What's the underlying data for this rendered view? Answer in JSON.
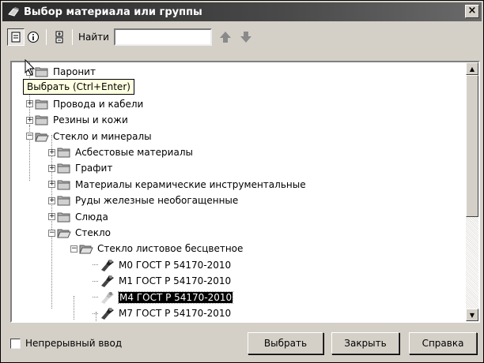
{
  "window": {
    "title": "Выбор материала или группы",
    "close_glyph": "×"
  },
  "toolbar": {
    "select_icon": "select-icon",
    "info_icon": "info-icon",
    "expand_icon": "expand-collapse-icon",
    "find_label": "Найти",
    "find_value": "",
    "up_icon": "arrow-up-icon",
    "down_icon": "arrow-down-icon"
  },
  "tooltip": "Выбрать (Ctrl+Enter)",
  "tree": [
    {
      "label": "Паронит",
      "level": 1,
      "type": "folder",
      "expand": "+"
    },
    {
      "label": "Провода и кабели",
      "level": 1,
      "type": "folder",
      "expand": "+"
    },
    {
      "label": "Резины и кожи",
      "level": 1,
      "type": "folder",
      "expand": "+"
    },
    {
      "label": "Стекло и минералы",
      "level": 1,
      "type": "folder-open",
      "expand": "−"
    },
    {
      "label": "Асбестовые материалы",
      "level": 2,
      "type": "folder",
      "expand": "+"
    },
    {
      "label": "Графит",
      "level": 2,
      "type": "folder",
      "expand": "+"
    },
    {
      "label": "Материалы керамические инструментальные",
      "level": 2,
      "type": "folder",
      "expand": "+"
    },
    {
      "label": "Руды железные необогащенные",
      "level": 2,
      "type": "folder",
      "expand": "+"
    },
    {
      "label": "Слюда",
      "level": 2,
      "type": "folder",
      "expand": "+"
    },
    {
      "label": "Стекло",
      "level": 2,
      "type": "folder-open",
      "expand": "−"
    },
    {
      "label": "Стекло листовое бесцветное",
      "level": 3,
      "type": "folder-open",
      "expand": "−"
    },
    {
      "label": "М0 ГОСТ Р 54170-2010",
      "level": 4,
      "type": "material"
    },
    {
      "label": "М1 ГОСТ Р 54170-2010",
      "level": 4,
      "type": "material"
    },
    {
      "label": "М4 ГОСТ Р 54170-2010",
      "level": 4,
      "type": "material",
      "selected": true
    },
    {
      "label": "М7 ГОСТ Р 54170-2010",
      "level": 4,
      "type": "material"
    }
  ],
  "footer": {
    "continuous_input_label": "Непрерывный ввод",
    "continuous_input_checked": false,
    "select_button": "Выбрать",
    "close_button": "Закрыть",
    "help_button": "Справка"
  }
}
